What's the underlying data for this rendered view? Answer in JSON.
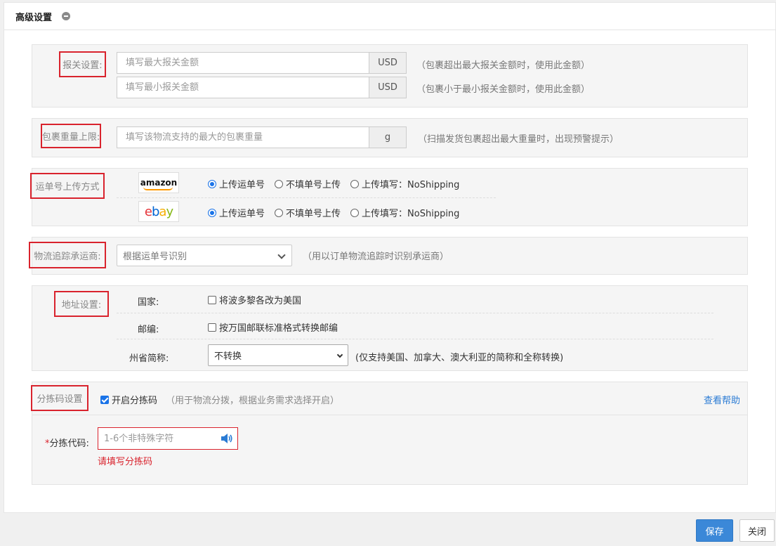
{
  "panel": {
    "title": "高级设置"
  },
  "customs": {
    "label": "报关设置:",
    "max_placeholder": "填写最大报关金额",
    "max_unit": "USD",
    "max_hint": "（包裹超出最大报关金额时，使用此金额）",
    "min_placeholder": "填写最小报关金额",
    "min_unit": "USD",
    "min_hint": "（包裹小于最小报关金额时，使用此金额）"
  },
  "weight": {
    "label": "包裹重量上限:",
    "placeholder": "填写该物流支持的最大的包裹重量",
    "unit": "g",
    "hint": "（扫描发货包裹超出最大重量时，出现预警提示）"
  },
  "upload": {
    "label": "运单号上传方式",
    "platforms": [
      {
        "logo": "amazon",
        "options": [
          "上传运单号",
          "不填单号上传",
          "上传填写：NoShipping"
        ],
        "selected": 0
      },
      {
        "logo": "ebay",
        "options": [
          "上传运单号",
          "不填单号上传",
          "上传填写：NoShipping"
        ],
        "selected": 0
      }
    ]
  },
  "carrier": {
    "label": "物流追踪承运商:",
    "selected": "根据运单号识别",
    "hint": "（用以订单物流追踪时识别承运商）"
  },
  "address": {
    "label": "地址设置:",
    "country_label": "国家:",
    "country_option": "将波多黎各改为美国",
    "country_checked": false,
    "zip_label": "邮编:",
    "zip_option": "按万国邮联标准格式转换邮编",
    "zip_checked": false,
    "state_label": "州省简称:",
    "state_selected": "不转换",
    "state_hint": "(仅支持美国、加拿大、澳大利亚的简称和全称转换)"
  },
  "sort": {
    "label": "分拣码设置",
    "enable_label": "开启分拣码",
    "enable_checked": true,
    "enable_hint": "（用于物流分拨，根据业务需求选择开启）",
    "help_link": "查看帮助",
    "code_required": "*",
    "code_label": "分拣代码:",
    "code_placeholder": "1-6个非特殊字符",
    "error": "请填写分拣码"
  },
  "footer": {
    "save": "保存",
    "close": "关闭"
  },
  "colors": {
    "accent": "#3b88d8",
    "error": "#d9232d",
    "link": "#2a7bd4"
  }
}
